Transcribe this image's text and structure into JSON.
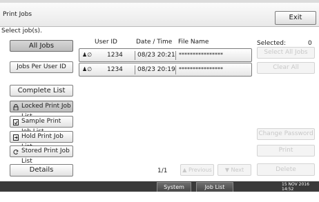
{
  "title_bar": {
    "title": "Print Jobs",
    "exit_label": "Exit"
  },
  "instruction": "Select job(s).",
  "left_panel": {
    "all_jobs": "All Jobs",
    "jobs_per_user_id": "Jobs Per User ID",
    "complete_list": "Complete List",
    "locked_list": "Locked Print Job List",
    "sample_list": "Sample Print Job List",
    "hold_list": "Hold Print Job List",
    "stored_list": "Stored Print Job List",
    "details": "Details"
  },
  "table": {
    "headers": {
      "user_id": "User ID",
      "date_time": "Date / Time",
      "file_name": "File Name"
    },
    "rows": [
      {
        "user_id": "1234",
        "date_time": "08/23 20:21",
        "file_name": "****************"
      },
      {
        "user_id": "1234",
        "date_time": "08/23 20:19",
        "file_name": "****************"
      }
    ]
  },
  "pagination": {
    "page": "1/1",
    "previous_label": "Previous",
    "next_label": "Next"
  },
  "right_panel": {
    "selected_label": "Selected:",
    "selected_count": "0",
    "select_all_jobs": "Select All Jobs",
    "clear_all": "Clear All",
    "change_password": "Change Password",
    "print": "Print",
    "delete": "Delete"
  },
  "status_bar": {
    "system_status": "System Status",
    "job_list": "Job List",
    "date": "15 NOV  2016",
    "time": "14:52"
  },
  "icons": {
    "user_lock": "person-lock-icon",
    "locked": "lock-icon",
    "sample": "sample-print-icon",
    "hold": "hold-print-icon",
    "stored": "stored-print-icon",
    "prev_arrow": "up-triangle-icon",
    "next_arrow": "down-triangle-icon"
  }
}
